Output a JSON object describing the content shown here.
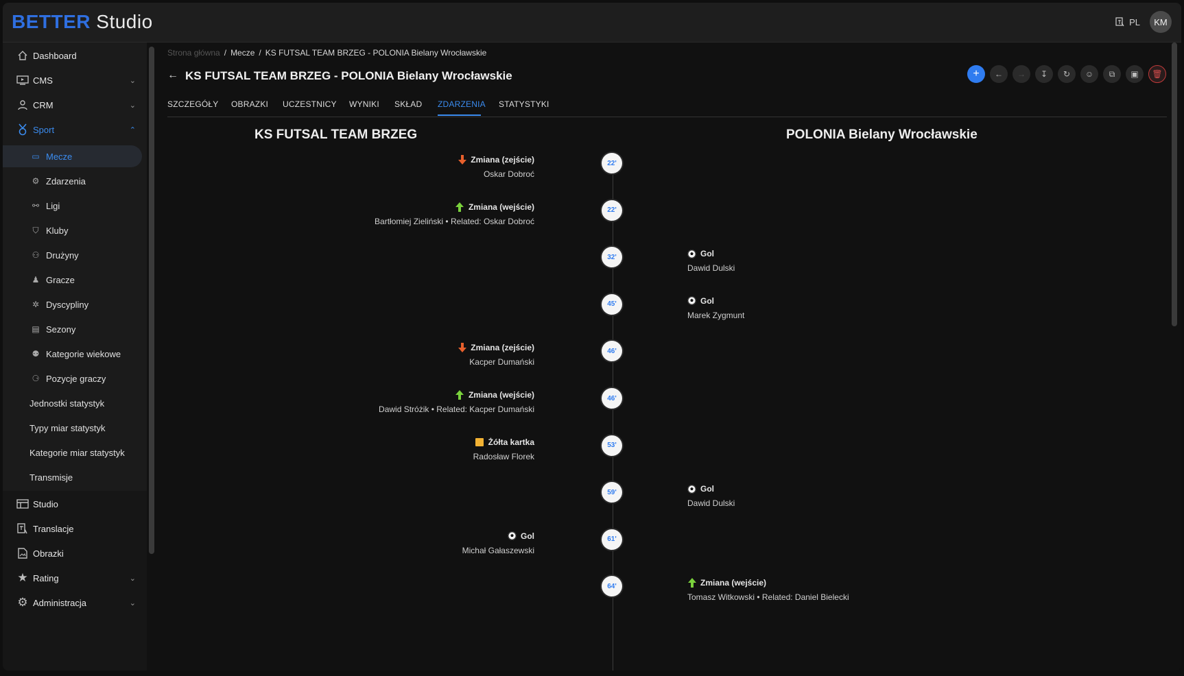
{
  "app": {
    "logo_bold": "BETTER",
    "logo_rest": " Studio",
    "lang": "PL",
    "user_initials": "KM"
  },
  "sidebar": {
    "dashboard": "Dashboard",
    "cms": "CMS",
    "crm": "CRM",
    "sport": "Sport",
    "sport_items": [
      "Mecze",
      "Zdarzenia",
      "Ligi",
      "Kluby",
      "Drużyny",
      "Gracze",
      "Dyscypliny",
      "Sezony",
      "Kategorie wiekowe",
      "Pozycje graczy",
      "Jednostki statystyk",
      "Typy miar statystyk",
      "Kategorie miar statystyk",
      "Transmisje"
    ],
    "studio": "Studio",
    "translacje": "Translacje",
    "obrazki": "Obrazki",
    "rating": "Rating",
    "administracja": "Administracja"
  },
  "breadcrumb": {
    "home": "Strona główna",
    "sep": "/",
    "matches": "Mecze",
    "current": "KS FUTSAL TEAM BRZEG - POLONIA Bielany Wrocławskie"
  },
  "page": {
    "title": "KS FUTSAL TEAM BRZEG - POLONIA Bielany Wrocławskie"
  },
  "tabs": [
    "SZCZEGÓŁY",
    "OBRAZKI",
    "UCZESTNICY",
    "WYNIKI",
    "SKŁAD",
    "ZDARZENIA",
    "STATYSTYKI"
  ],
  "active_tab": "ZDARZENIA",
  "teams": {
    "home": "KS FUTSAL TEAM BRZEG",
    "away": "POLONIA Bielany Wrocławskie"
  },
  "events": [
    {
      "minute": "22'",
      "side": "home",
      "type": "sub-out",
      "title": "Zmiana (zejście)",
      "detail": "Oskar Dobroć"
    },
    {
      "minute": "22'",
      "side": "home",
      "type": "sub-in",
      "title": "Zmiana (wejście)",
      "detail": "Bartłomiej Zieliński • Related: Oskar Dobroć"
    },
    {
      "minute": "32'",
      "side": "away",
      "type": "goal",
      "title": "Gol",
      "detail": "Dawid Dulski"
    },
    {
      "minute": "45'",
      "side": "away",
      "type": "goal",
      "title": "Gol",
      "detail": "Marek Zygmunt"
    },
    {
      "minute": "46'",
      "side": "home",
      "type": "sub-out",
      "title": "Zmiana (zejście)",
      "detail": "Kacper Dumański"
    },
    {
      "minute": "46'",
      "side": "home",
      "type": "sub-in",
      "title": "Zmiana (wejście)",
      "detail": "Dawid Stróżik • Related: Kacper Dumański"
    },
    {
      "minute": "53'",
      "side": "home",
      "type": "yellow-card",
      "title": "Żółta kartka",
      "detail": "Radosław Florek"
    },
    {
      "minute": "59'",
      "side": "away",
      "type": "goal",
      "title": "Gol",
      "detail": "Dawid Dulski"
    },
    {
      "minute": "61'",
      "side": "home",
      "type": "goal",
      "title": "Gol",
      "detail": "Michał Gałaszewski"
    },
    {
      "minute": "64'",
      "side": "away",
      "type": "sub-in",
      "title": "Zmiana (wejście)",
      "detail": "Tomasz Witkowski • Related: Daniel Bielecki"
    }
  ],
  "colors": {
    "accent": "#2f7cf0",
    "sub_out": "#e8602c",
    "sub_in": "#7ad13c",
    "yellow_card": "#f2b233"
  }
}
